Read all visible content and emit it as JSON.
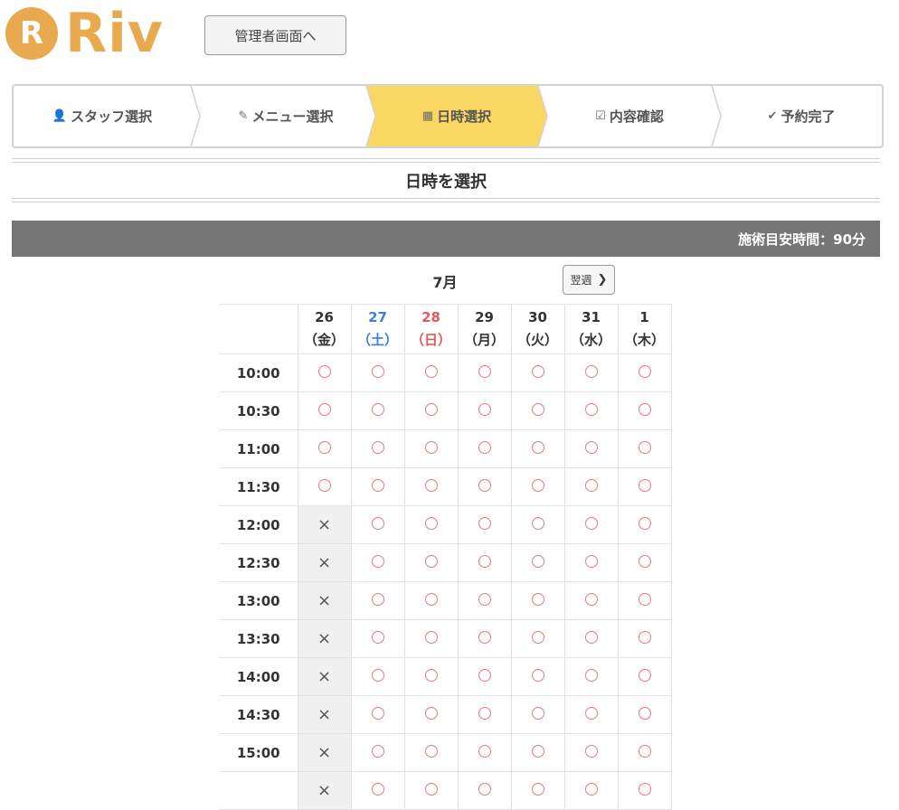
{
  "header": {
    "logo_letter": "R",
    "logo_text": "Riv",
    "admin_button": "管理者画面へ"
  },
  "steps": [
    {
      "icon": "user-icon",
      "glyph": "👤",
      "label": "スタッフ選択",
      "active": false
    },
    {
      "icon": "pencil-icon",
      "glyph": "✎",
      "label": "メニュー選択",
      "active": false
    },
    {
      "icon": "calendar-icon",
      "glyph": "▦",
      "label": "日時選択",
      "active": true
    },
    {
      "icon": "checkbox-icon",
      "glyph": "☑",
      "label": "内容確認",
      "active": false
    },
    {
      "icon": "check-icon",
      "glyph": "✔",
      "label": "予約完了",
      "active": false
    }
  ],
  "page_title": "日時を選択",
  "duration_text": "施術目安時間：90分",
  "calendar": {
    "month": "7月",
    "next_week": "翌週",
    "days": [
      {
        "date": "26",
        "weekday": "（金）",
        "type": "weekday"
      },
      {
        "date": "27",
        "weekday": "（土）",
        "type": "sat"
      },
      {
        "date": "28",
        "weekday": "（日）",
        "type": "sun"
      },
      {
        "date": "29",
        "weekday": "（月）",
        "type": "weekday"
      },
      {
        "date": "30",
        "weekday": "（火）",
        "type": "weekday"
      },
      {
        "date": "31",
        "weekday": "（水）",
        "type": "weekday"
      },
      {
        "date": "1",
        "weekday": "（木）",
        "type": "weekday"
      }
    ],
    "rows": [
      {
        "time": "10:00",
        "slots": [
          "○",
          "○",
          "○",
          "○",
          "○",
          "○",
          "○"
        ]
      },
      {
        "time": "10:30",
        "slots": [
          "○",
          "○",
          "○",
          "○",
          "○",
          "○",
          "○"
        ]
      },
      {
        "time": "11:00",
        "slots": [
          "○",
          "○",
          "○",
          "○",
          "○",
          "○",
          "○"
        ]
      },
      {
        "time": "11:30",
        "slots": [
          "○",
          "○",
          "○",
          "○",
          "○",
          "○",
          "○"
        ]
      },
      {
        "time": "12:00",
        "slots": [
          "×",
          "○",
          "○",
          "○",
          "○",
          "○",
          "○"
        ]
      },
      {
        "time": "12:30",
        "slots": [
          "×",
          "○",
          "○",
          "○",
          "○",
          "○",
          "○"
        ]
      },
      {
        "time": "13:00",
        "slots": [
          "×",
          "○",
          "○",
          "○",
          "○",
          "○",
          "○"
        ]
      },
      {
        "time": "13:30",
        "slots": [
          "×",
          "○",
          "○",
          "○",
          "○",
          "○",
          "○"
        ]
      },
      {
        "time": "14:00",
        "slots": [
          "×",
          "○",
          "○",
          "○",
          "○",
          "○",
          "○"
        ]
      },
      {
        "time": "14:30",
        "slots": [
          "×",
          "○",
          "○",
          "○",
          "○",
          "○",
          "○"
        ]
      },
      {
        "time": "15:00",
        "slots": [
          "×",
          "○",
          "○",
          "○",
          "○",
          "○",
          "○"
        ]
      },
      {
        "time": "",
        "slots": [
          "×",
          "○",
          "○",
          "○",
          "○",
          "○",
          "○"
        ]
      }
    ]
  },
  "colors": {
    "brand": "#e9a94f",
    "active_step": "#fad763",
    "available": "#e8787e",
    "saturday": "#3f7fdc",
    "sunday": "#e25b5b",
    "bar": "#767676"
  }
}
